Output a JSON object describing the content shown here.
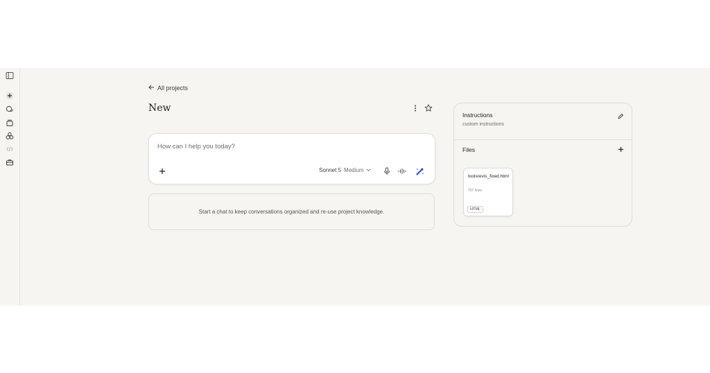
{
  "nav": {
    "back_label": "All projects"
  },
  "project": {
    "title": "New"
  },
  "composer": {
    "placeholder": "How can I help you today?",
    "model_name": "Sonnet 5",
    "model_level": "Medium"
  },
  "empty_state": {
    "text": "Start a chat to keep conversations organized and re-use project knowledge."
  },
  "instructions": {
    "title": "Instructions",
    "subtitle": "custom instructions"
  },
  "files": {
    "title": "Files",
    "items": [
      {
        "name": "toolsrevis_fixed.html",
        "lines": "757 lines",
        "type": "HTML"
      }
    ]
  },
  "colors": {
    "accent": "#2f4fd6",
    "background": "#f6f5f1",
    "card": "#ffffff"
  },
  "icons": [
    "sidebar-toggle-icon",
    "new-chat-icon",
    "chats-icon",
    "projects-icon",
    "artifacts-icon",
    "code-icon",
    "briefcase-icon",
    "more-icon",
    "star-icon",
    "plus-icon",
    "chevron-down-icon",
    "microphone-icon",
    "voice-icon",
    "sparkle-icon",
    "edit-icon"
  ]
}
